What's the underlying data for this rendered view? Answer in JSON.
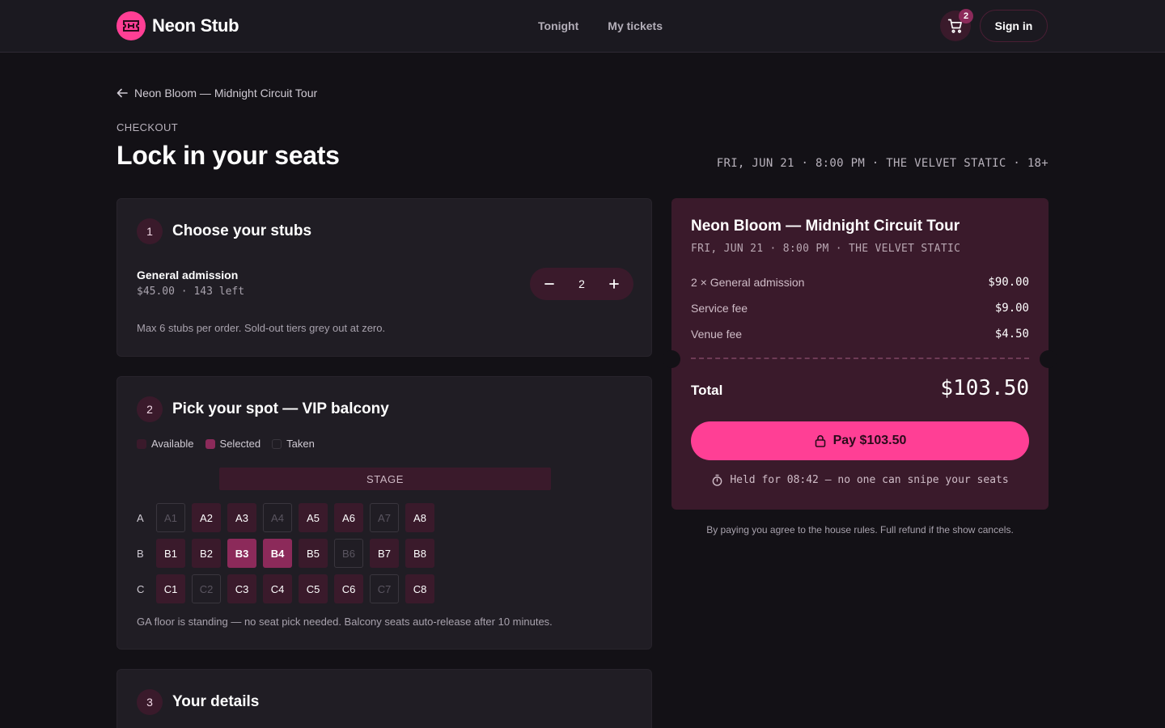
{
  "brand": {
    "name": "Neon Stub"
  },
  "nav": {
    "links": [
      "Tonight",
      "My tickets"
    ],
    "cart_count": "2",
    "signin_label": "Sign in"
  },
  "header": {
    "back_label": "Neon Bloom — Midnight Circuit Tour",
    "eyebrow": "CHECKOUT",
    "title": "Lock in your seats",
    "event_meta": "FRI, JUN 21 · 8:00 PM · THE VELVET STATIC · 18+"
  },
  "step1": {
    "num": "1",
    "title": "Choose your stubs",
    "tier_name": "General admission",
    "tier_meta": "$45.00 · 143 left",
    "quantity": "2",
    "note": "Max 6 stubs per order. Sold-out tiers grey out at zero."
  },
  "step2": {
    "num": "2",
    "title": "Pick your spot — VIP balcony",
    "legend": {
      "available": "Available",
      "selected": "Selected",
      "taken": "Taken"
    },
    "stage_label": "STAGE",
    "rows": [
      {
        "label": "A",
        "seats": [
          {
            "id": "A1",
            "status": "taken"
          },
          {
            "id": "A2",
            "status": "available"
          },
          {
            "id": "A3",
            "status": "available"
          },
          {
            "id": "A4",
            "status": "taken"
          },
          {
            "id": "A5",
            "status": "available"
          },
          {
            "id": "A6",
            "status": "available"
          },
          {
            "id": "A7",
            "status": "taken"
          },
          {
            "id": "A8",
            "status": "available"
          }
        ]
      },
      {
        "label": "B",
        "seats": [
          {
            "id": "B1",
            "status": "available"
          },
          {
            "id": "B2",
            "status": "available"
          },
          {
            "id": "B3",
            "status": "selected"
          },
          {
            "id": "B4",
            "status": "selected"
          },
          {
            "id": "B5",
            "status": "available"
          },
          {
            "id": "B6",
            "status": "taken"
          },
          {
            "id": "B7",
            "status": "available"
          },
          {
            "id": "B8",
            "status": "available"
          }
        ]
      },
      {
        "label": "C",
        "seats": [
          {
            "id": "C1",
            "status": "available"
          },
          {
            "id": "C2",
            "status": "taken"
          },
          {
            "id": "C3",
            "status": "available"
          },
          {
            "id": "C4",
            "status": "available"
          },
          {
            "id": "C5",
            "status": "available"
          },
          {
            "id": "C6",
            "status": "available"
          },
          {
            "id": "C7",
            "status": "taken"
          },
          {
            "id": "C8",
            "status": "available"
          }
        ]
      }
    ],
    "note": "GA floor is standing — no seat pick needed. Balcony seats auto-release after 10 minutes."
  },
  "step3": {
    "num": "3",
    "title": "Your details"
  },
  "summary": {
    "title": "Neon Bloom — Midnight Circuit Tour",
    "meta": "FRI, JUN 21 · 8:00 PM · THE VELVET STATIC",
    "items": [
      {
        "label": "2 × General admission",
        "amount": "$90.00"
      },
      {
        "label": "Service fee",
        "amount": "$9.00"
      },
      {
        "label": "Venue fee",
        "amount": "$4.50"
      }
    ],
    "total_label": "Total",
    "total_amount": "$103.50",
    "pay_label": "Pay $103.50",
    "hold_text": "Held for 08:42 — no one can snipe your seats",
    "legal": "By paying you agree to the house rules. Full refund if the show cancels."
  },
  "colors": {
    "accent": "#ff3f95",
    "panel": "#3a1a2b",
    "selected": "#8c2a5a",
    "background": "#131116"
  }
}
